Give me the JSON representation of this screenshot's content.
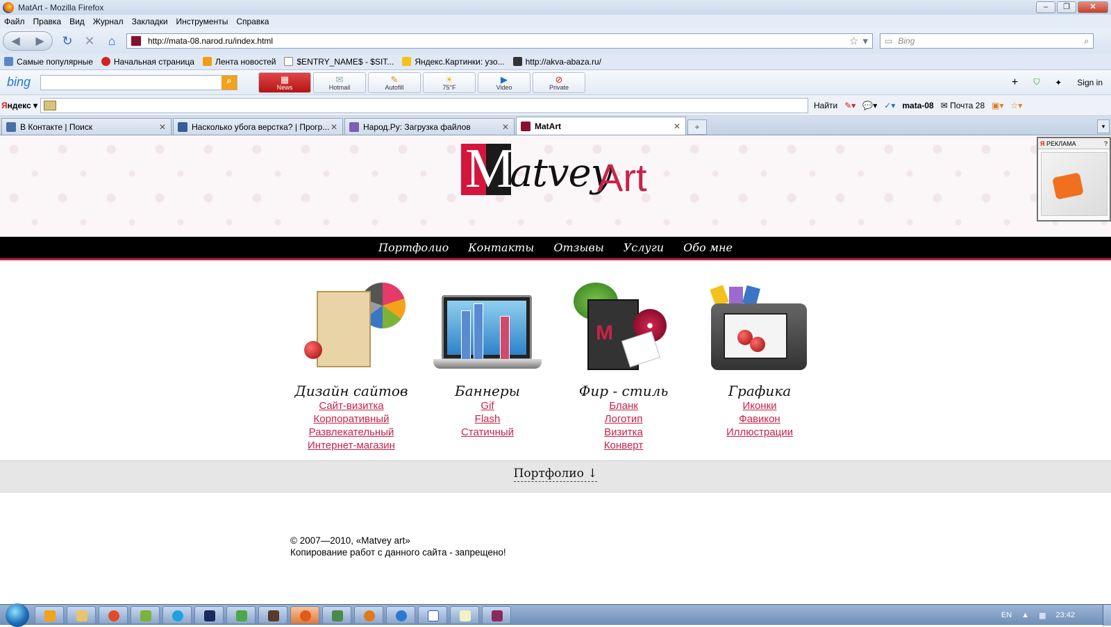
{
  "window": {
    "title": "MatArt - Mozilla Firefox"
  },
  "menu": [
    "Файл",
    "Правка",
    "Вид",
    "Журнал",
    "Закладки",
    "Инструменты",
    "Справка"
  ],
  "nav": {
    "url": "http://mata-08.narod.ru/index.html",
    "search_placeholder": "Bing"
  },
  "bookmarks": [
    "Самые популярные",
    "Начальная страница",
    "Лента новостей",
    "$ENTRY_NAME$ - $SIT...",
    "Яндекс.Картинки: узо...",
    "http://akva-abaza.ru/"
  ],
  "bingbar": {
    "logo": "bing",
    "buttons": [
      {
        "label": "News",
        "icon": "newspaper-icon"
      },
      {
        "label": "Hotmail",
        "icon": "mail-icon"
      },
      {
        "label": "Autofill",
        "icon": "pencil-icon"
      },
      {
        "label": "75°F",
        "icon": "sun-icon"
      },
      {
        "label": "Video",
        "icon": "play-icon"
      },
      {
        "label": "Private",
        "icon": "private-icon"
      }
    ],
    "signin": "Sign in",
    "plus": "+"
  },
  "yandexbar": {
    "logo_y": "Я",
    "logo_rest": "ндекс",
    "find": "Найти",
    "user": "mata-08",
    "mail": "Почта 28"
  },
  "tabs": [
    {
      "label": "В Контакте | Поиск",
      "color": "#4a6ea6"
    },
    {
      "label": "Насколько убога верстка? | Прогр...",
      "color": "#3b5b94"
    },
    {
      "label": "Народ.Ру: Загрузка файлов",
      "color": "#7b5fb0"
    },
    {
      "label": "MatArt",
      "color": "#8a0e2e"
    }
  ],
  "site": {
    "logo": {
      "m": "M",
      "matvey": "atvey",
      "art": "Art"
    },
    "ad_label": "РЕКЛАМА",
    "ad_controls": "?",
    "nav": [
      "Портфолио",
      "Контакты",
      "Отзывы",
      "Услуги",
      "Обо мне"
    ],
    "services": [
      {
        "title": "Дизайн сайтов",
        "links": [
          "Сайт-визитка",
          "Корпоративный",
          "Развлекательный",
          "Интернет-магазин"
        ]
      },
      {
        "title": "Баннеры",
        "links": [
          "Gif",
          "Flash",
          "Статичный"
        ]
      },
      {
        "title": "Фир - стиль",
        "links": [
          "Бланк",
          "Логотип",
          "Визитка",
          "Конверт"
        ]
      },
      {
        "title": "Графика",
        "links": [
          "Иконки",
          "Фавикон",
          "Иллюстрации"
        ]
      }
    ],
    "portfolio_bar": "Портфолио ↓",
    "footer": {
      "copyright": "© 2007—2010, «Matvey art»",
      "notice": "Копирование работ с данного сайта - запрещено!"
    }
  },
  "taskbar": {
    "lang": "EN",
    "clock": "23:42"
  },
  "colors": {
    "accent": "#c8224a",
    "nav_bg": "#000000"
  }
}
